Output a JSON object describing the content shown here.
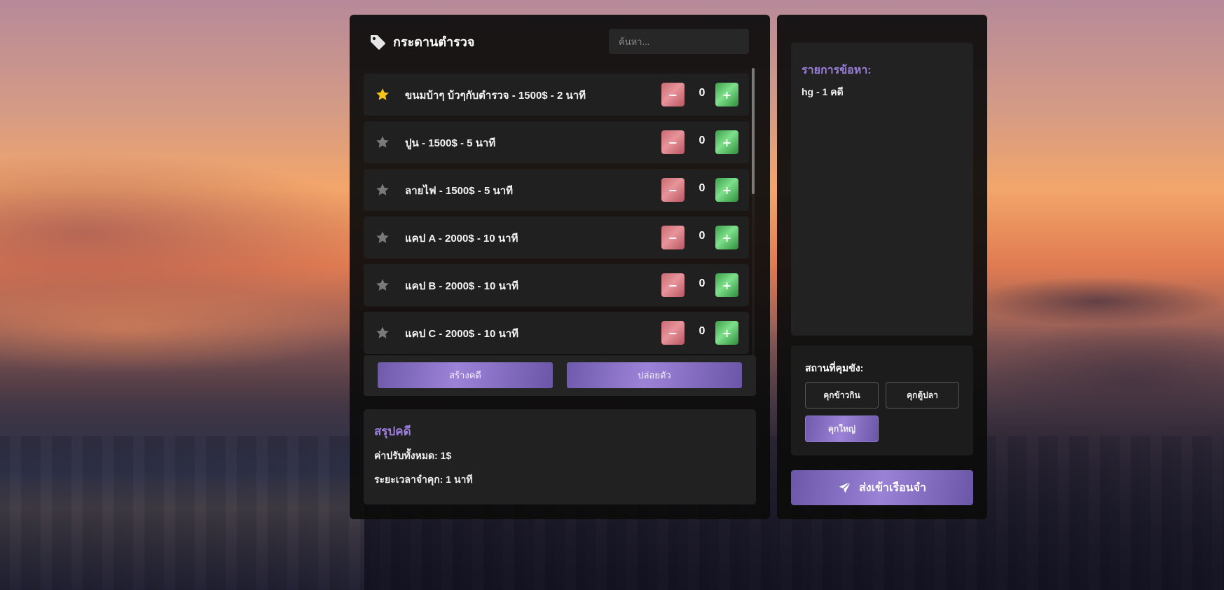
{
  "colors": {
    "accent": "#9d7fe0",
    "minus": "#d9767f",
    "plus": "#4fbf5c",
    "star_active": "#f5c518",
    "star_inactive": "#7a7a7a"
  },
  "board": {
    "title": "กระดานตำรวจ",
    "icon": "tag-icon",
    "search_placeholder": "ค้นหา...",
    "items": [
      {
        "label": "ขนมบ้าๆ บ้วๆกับตำรวจ - 1500$ - 2 นาที",
        "count": "0",
        "favorite": true
      },
      {
        "label": "ปูน - 1500$ - 5 นาที",
        "count": "0",
        "favorite": false
      },
      {
        "label": "ลายไฟ - 1500$ - 5 นาที",
        "count": "0",
        "favorite": false
      },
      {
        "label": "แคป A - 2000$ - 10 นาที",
        "count": "0",
        "favorite": false
      },
      {
        "label": "แคป B - 2000$ - 10 นาที",
        "count": "0",
        "favorite": false
      },
      {
        "label": "แคป C - 2000$ - 10 นาที",
        "count": "0",
        "favorite": false
      }
    ],
    "minus_label": "−",
    "plus_label": "+",
    "create_case_label": "สร้างคดี",
    "release_label": "ปล่อยตัว"
  },
  "summary": {
    "title": "สรุปคดี",
    "total_fine": "ค่าปรับทั้งหมด: 1$",
    "jail_time": "ระยะเวลาจำคุก: 1 นาที"
  },
  "charges": {
    "title": "รายการข้อหา:",
    "items": [
      "hg - 1 คดี"
    ]
  },
  "jail": {
    "title": "สถานที่คุมขัง:",
    "options": [
      "คุกข้าวกิน",
      "คุกตู้ปลา",
      "คุกใหญ่"
    ],
    "selected": "คุกใหญ่"
  },
  "send_button": {
    "label": "ส่งเข้าเรือนจำ",
    "icon": "paper-plane-icon"
  }
}
